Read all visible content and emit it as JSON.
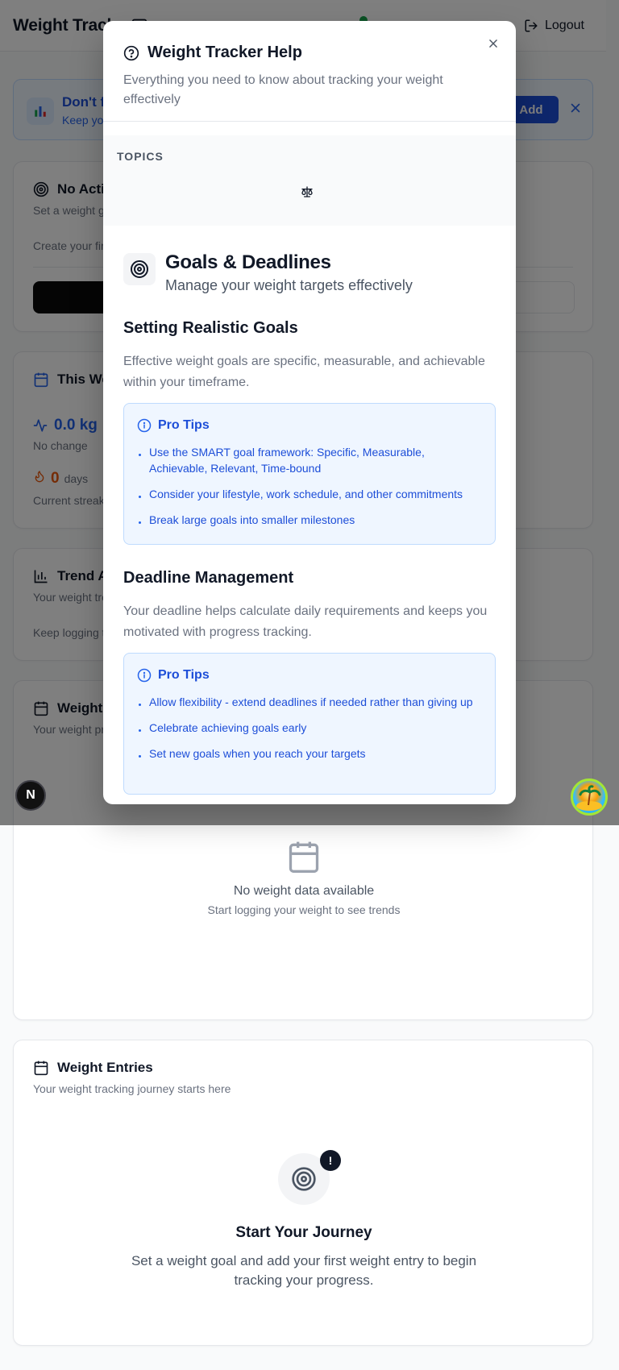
{
  "header": {
    "app_title": "Weight Tracker",
    "logout_label": "Logout"
  },
  "banner": {
    "title": "Don't forget to log your weight today!",
    "subtitle": "Keep your streak going",
    "add_label": "Add"
  },
  "goal_card": {
    "title": "No Active Goal",
    "subtitle": "Set a weight goal to start tracking your progress",
    "create_text": "Create your first goal to get started"
  },
  "week_card": {
    "title": "This Week",
    "change_value": "0.0 kg",
    "change_label": "No change",
    "streak_value": "0",
    "streak_unit": "days",
    "streak_label": "Current streak"
  },
  "trend_card": {
    "title": "Trend Analysis",
    "subtitle": "Your weight trend over time",
    "keep_text": "Keep logging to see your trends"
  },
  "graph_card": {
    "title": "Weight Trend",
    "subtitle": "Your weight progress over time",
    "empty_title": "No weight data available",
    "empty_sub": "Start logging your weight to see trends"
  },
  "entries_card": {
    "title": "Weight Entries",
    "subtitle": "Your weight tracking journey starts here",
    "badge": "!",
    "journey_title": "Start Your Journey",
    "journey_text": "Set a weight goal and add your first weight entry to begin tracking your progress."
  },
  "floating": {
    "next_label": "N"
  },
  "modal": {
    "title": "Weight Tracker Help",
    "subtitle": "Everything you need to know about tracking your weight effectively",
    "topics_label": "TOPICS",
    "section": {
      "title": "Goals & Deadlines",
      "subtitle": "Manage your weight targets effectively"
    },
    "blocks": [
      {
        "heading": "Setting Realistic Goals",
        "description": "Effective weight goals are specific, measurable, and achievable within your timeframe.",
        "tips_title": "Pro Tips",
        "tips": [
          "Use the SMART goal framework: Specific, Measurable, Achievable, Relevant, Time-bound",
          "Consider your lifestyle, work schedule, and other commitments",
          "Break large goals into smaller milestones"
        ]
      },
      {
        "heading": "Deadline Management",
        "description": "Your deadline helps calculate daily requirements and keeps you motivated with progress tracking.",
        "tips_title": "Pro Tips",
        "tips": [
          "Allow flexibility - extend deadlines if needed rather than giving up",
          "Celebrate achieving goals early",
          "Set new goals when you reach your targets"
        ]
      }
    ]
  },
  "colors": {
    "accent_blue": "#1d4ed8",
    "tip_bg": "#eff6ff",
    "streak_orange": "#ea580c",
    "overlay": "rgba(0,0,0,0.5)"
  },
  "icons": {
    "modal_title": "help-circle-icon",
    "close": "close-icon",
    "topic": "scale-icon",
    "section": "target-icon",
    "tips": "info-icon",
    "logout": "logout-icon",
    "banner": "bar-chart-icon",
    "week": "calendar-icon",
    "change": "activity-icon",
    "streak": "flame-icon",
    "trend": "bar-chart-icon",
    "graph": "calendar-icon",
    "entries": "calendar-icon"
  }
}
